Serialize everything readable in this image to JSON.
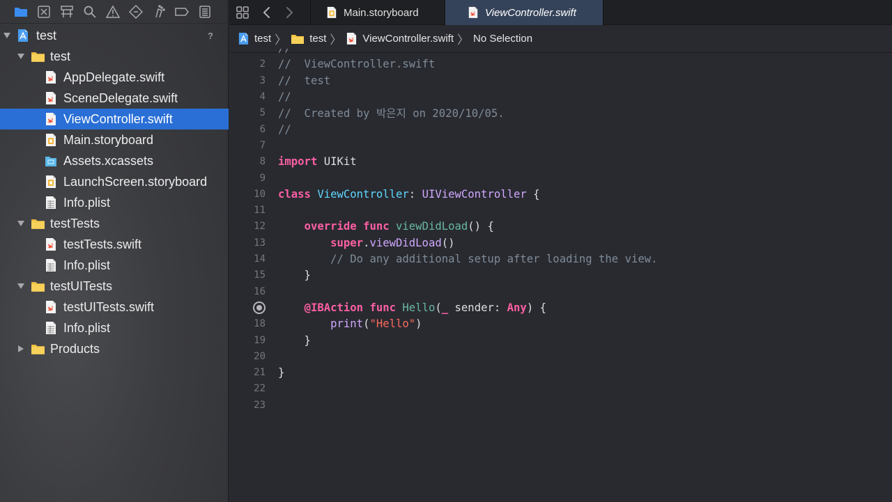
{
  "navigator": {
    "toolbar_icons": [
      "folder-icon",
      "source-control-icon",
      "symbol-navigator-icon",
      "search-icon",
      "issue-icon",
      "test-icon",
      "debug-icon",
      "breakpoint-icon",
      "report-icon"
    ],
    "root": {
      "label": "test",
      "badge": "?"
    },
    "items": [
      {
        "label": "test",
        "kind": "folder",
        "indent": 1,
        "expanded": true
      },
      {
        "label": "AppDelegate.swift",
        "kind": "swift",
        "indent": 2
      },
      {
        "label": "SceneDelegate.swift",
        "kind": "swift",
        "indent": 2
      },
      {
        "label": "ViewController.swift",
        "kind": "swift",
        "indent": 2,
        "selected": true
      },
      {
        "label": "Main.storyboard",
        "kind": "storyboard",
        "indent": 2
      },
      {
        "label": "Assets.xcassets",
        "kind": "assets",
        "indent": 2
      },
      {
        "label": "LaunchScreen.storyboard",
        "kind": "storyboard",
        "indent": 2
      },
      {
        "label": "Info.plist",
        "kind": "plist",
        "indent": 2
      },
      {
        "label": "testTests",
        "kind": "folder",
        "indent": 1,
        "expanded": true
      },
      {
        "label": "testTests.swift",
        "kind": "swift",
        "indent": 2
      },
      {
        "label": "Info.plist",
        "kind": "plist",
        "indent": 2
      },
      {
        "label": "testUITests",
        "kind": "folder",
        "indent": 1,
        "expanded": true
      },
      {
        "label": "testUITests.swift",
        "kind": "swift",
        "indent": 2
      },
      {
        "label": "Info.plist",
        "kind": "plist",
        "indent": 2
      },
      {
        "label": "Products",
        "kind": "folder",
        "indent": 1,
        "expanded": false
      }
    ]
  },
  "tabs": [
    {
      "label": "Main.storyboard",
      "kind": "storyboard",
      "active": false
    },
    {
      "label": "ViewController.swift",
      "kind": "swift",
      "active": true
    }
  ],
  "jumpbar": {
    "crumbs": [
      {
        "label": "test",
        "kind": "project"
      },
      {
        "label": "test",
        "kind": "folder"
      },
      {
        "label": "ViewController.swift",
        "kind": "swift"
      },
      {
        "label": "No Selection",
        "kind": "none"
      }
    ],
    "separator": "〉"
  },
  "code": {
    "lines": [
      {
        "n": "",
        "tokens": [
          [
            "c",
            "//"
          ]
        ]
      },
      {
        "n": "2",
        "tokens": [
          [
            "c",
            "//  ViewController.swift"
          ]
        ]
      },
      {
        "n": "3",
        "tokens": [
          [
            "c",
            "//  test"
          ]
        ]
      },
      {
        "n": "4",
        "tokens": [
          [
            "c",
            "//"
          ]
        ]
      },
      {
        "n": "5",
        "tokens": [
          [
            "c",
            "//  Created by 박은지 on 2020/10/05."
          ]
        ]
      },
      {
        "n": "6",
        "tokens": [
          [
            "c",
            "//"
          ]
        ]
      },
      {
        "n": "7",
        "tokens": []
      },
      {
        "n": "8",
        "tokens": [
          [
            "k",
            "import"
          ],
          [
            "p",
            " UIKit"
          ]
        ]
      },
      {
        "n": "9",
        "tokens": []
      },
      {
        "n": "10",
        "tokens": [
          [
            "k",
            "class"
          ],
          [
            "p",
            " "
          ],
          [
            "t",
            "ViewController"
          ],
          [
            "p",
            ": "
          ],
          [
            "r",
            "UIViewController"
          ],
          [
            "p",
            " {"
          ]
        ]
      },
      {
        "n": "11",
        "tokens": []
      },
      {
        "n": "12",
        "tokens": [
          [
            "p",
            "    "
          ],
          [
            "k",
            "override"
          ],
          [
            "p",
            " "
          ],
          [
            "k",
            "func"
          ],
          [
            "p",
            " "
          ],
          [
            "f",
            "viewDidLoad"
          ],
          [
            "p",
            "() {"
          ]
        ]
      },
      {
        "n": "13",
        "tokens": [
          [
            "p",
            "        "
          ],
          [
            "k",
            "super"
          ],
          [
            "p",
            "."
          ],
          [
            "r",
            "viewDidLoad"
          ],
          [
            "p",
            "()"
          ]
        ]
      },
      {
        "n": "14",
        "tokens": [
          [
            "p",
            "        "
          ],
          [
            "c",
            "// Do any additional setup after loading the view."
          ]
        ]
      },
      {
        "n": "15",
        "tokens": [
          [
            "p",
            "    }"
          ]
        ]
      },
      {
        "n": "16",
        "tokens": []
      },
      {
        "n": "",
        "breakpoint": true,
        "tokens": [
          [
            "p",
            "    "
          ],
          [
            "k",
            "@IBAction"
          ],
          [
            "p",
            " "
          ],
          [
            "k",
            "func"
          ],
          [
            "p",
            " "
          ],
          [
            "f",
            "Hello"
          ],
          [
            "p",
            "("
          ],
          [
            "k",
            "_"
          ],
          [
            "p",
            " sender: "
          ],
          [
            "k",
            "Any"
          ],
          [
            "p",
            ") {"
          ]
        ]
      },
      {
        "n": "18",
        "tokens": [
          [
            "p",
            "        "
          ],
          [
            "r",
            "print"
          ],
          [
            "p",
            "("
          ],
          [
            "s",
            "\"Hello\""
          ],
          [
            "p",
            ")"
          ]
        ]
      },
      {
        "n": "19",
        "tokens": [
          [
            "p",
            "    }"
          ]
        ]
      },
      {
        "n": "20",
        "tokens": []
      },
      {
        "n": "21",
        "tokens": [
          [
            "p",
            "}"
          ]
        ]
      },
      {
        "n": "22",
        "tokens": []
      },
      {
        "n": "23",
        "tokens": []
      }
    ]
  },
  "colors": {
    "selection": "#2a6fd6",
    "keyword": "#fc5fa3",
    "type_decl": "#5dd8ff",
    "type_ref": "#d0a8ff",
    "func_decl": "#67b7a4",
    "comment": "#7f8c98",
    "string": "#fc6a5d"
  }
}
